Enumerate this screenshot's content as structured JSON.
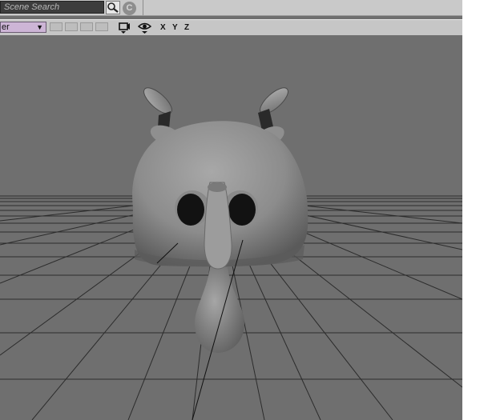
{
  "search": {
    "placeholder": "Scene Search"
  },
  "toolbar": {
    "layer_label": "er",
    "axis": {
      "x": "X",
      "y": "Y",
      "z": "Z"
    }
  },
  "icons": [
    "search-icon",
    "clear-icon",
    "dropdown-arrow-icon",
    "camera-icon",
    "eye-icon"
  ],
  "viewport": {
    "object": "mushroom-creature-head",
    "background": "#6f6f6f",
    "grid_color": "#2c2c2c"
  },
  "colors": {
    "topbar": "#c9c9c9",
    "toolbar": "#c6c6c6",
    "layer_dropdown": "#cdb5d6",
    "viewport_bg": "#6f6f6f"
  }
}
